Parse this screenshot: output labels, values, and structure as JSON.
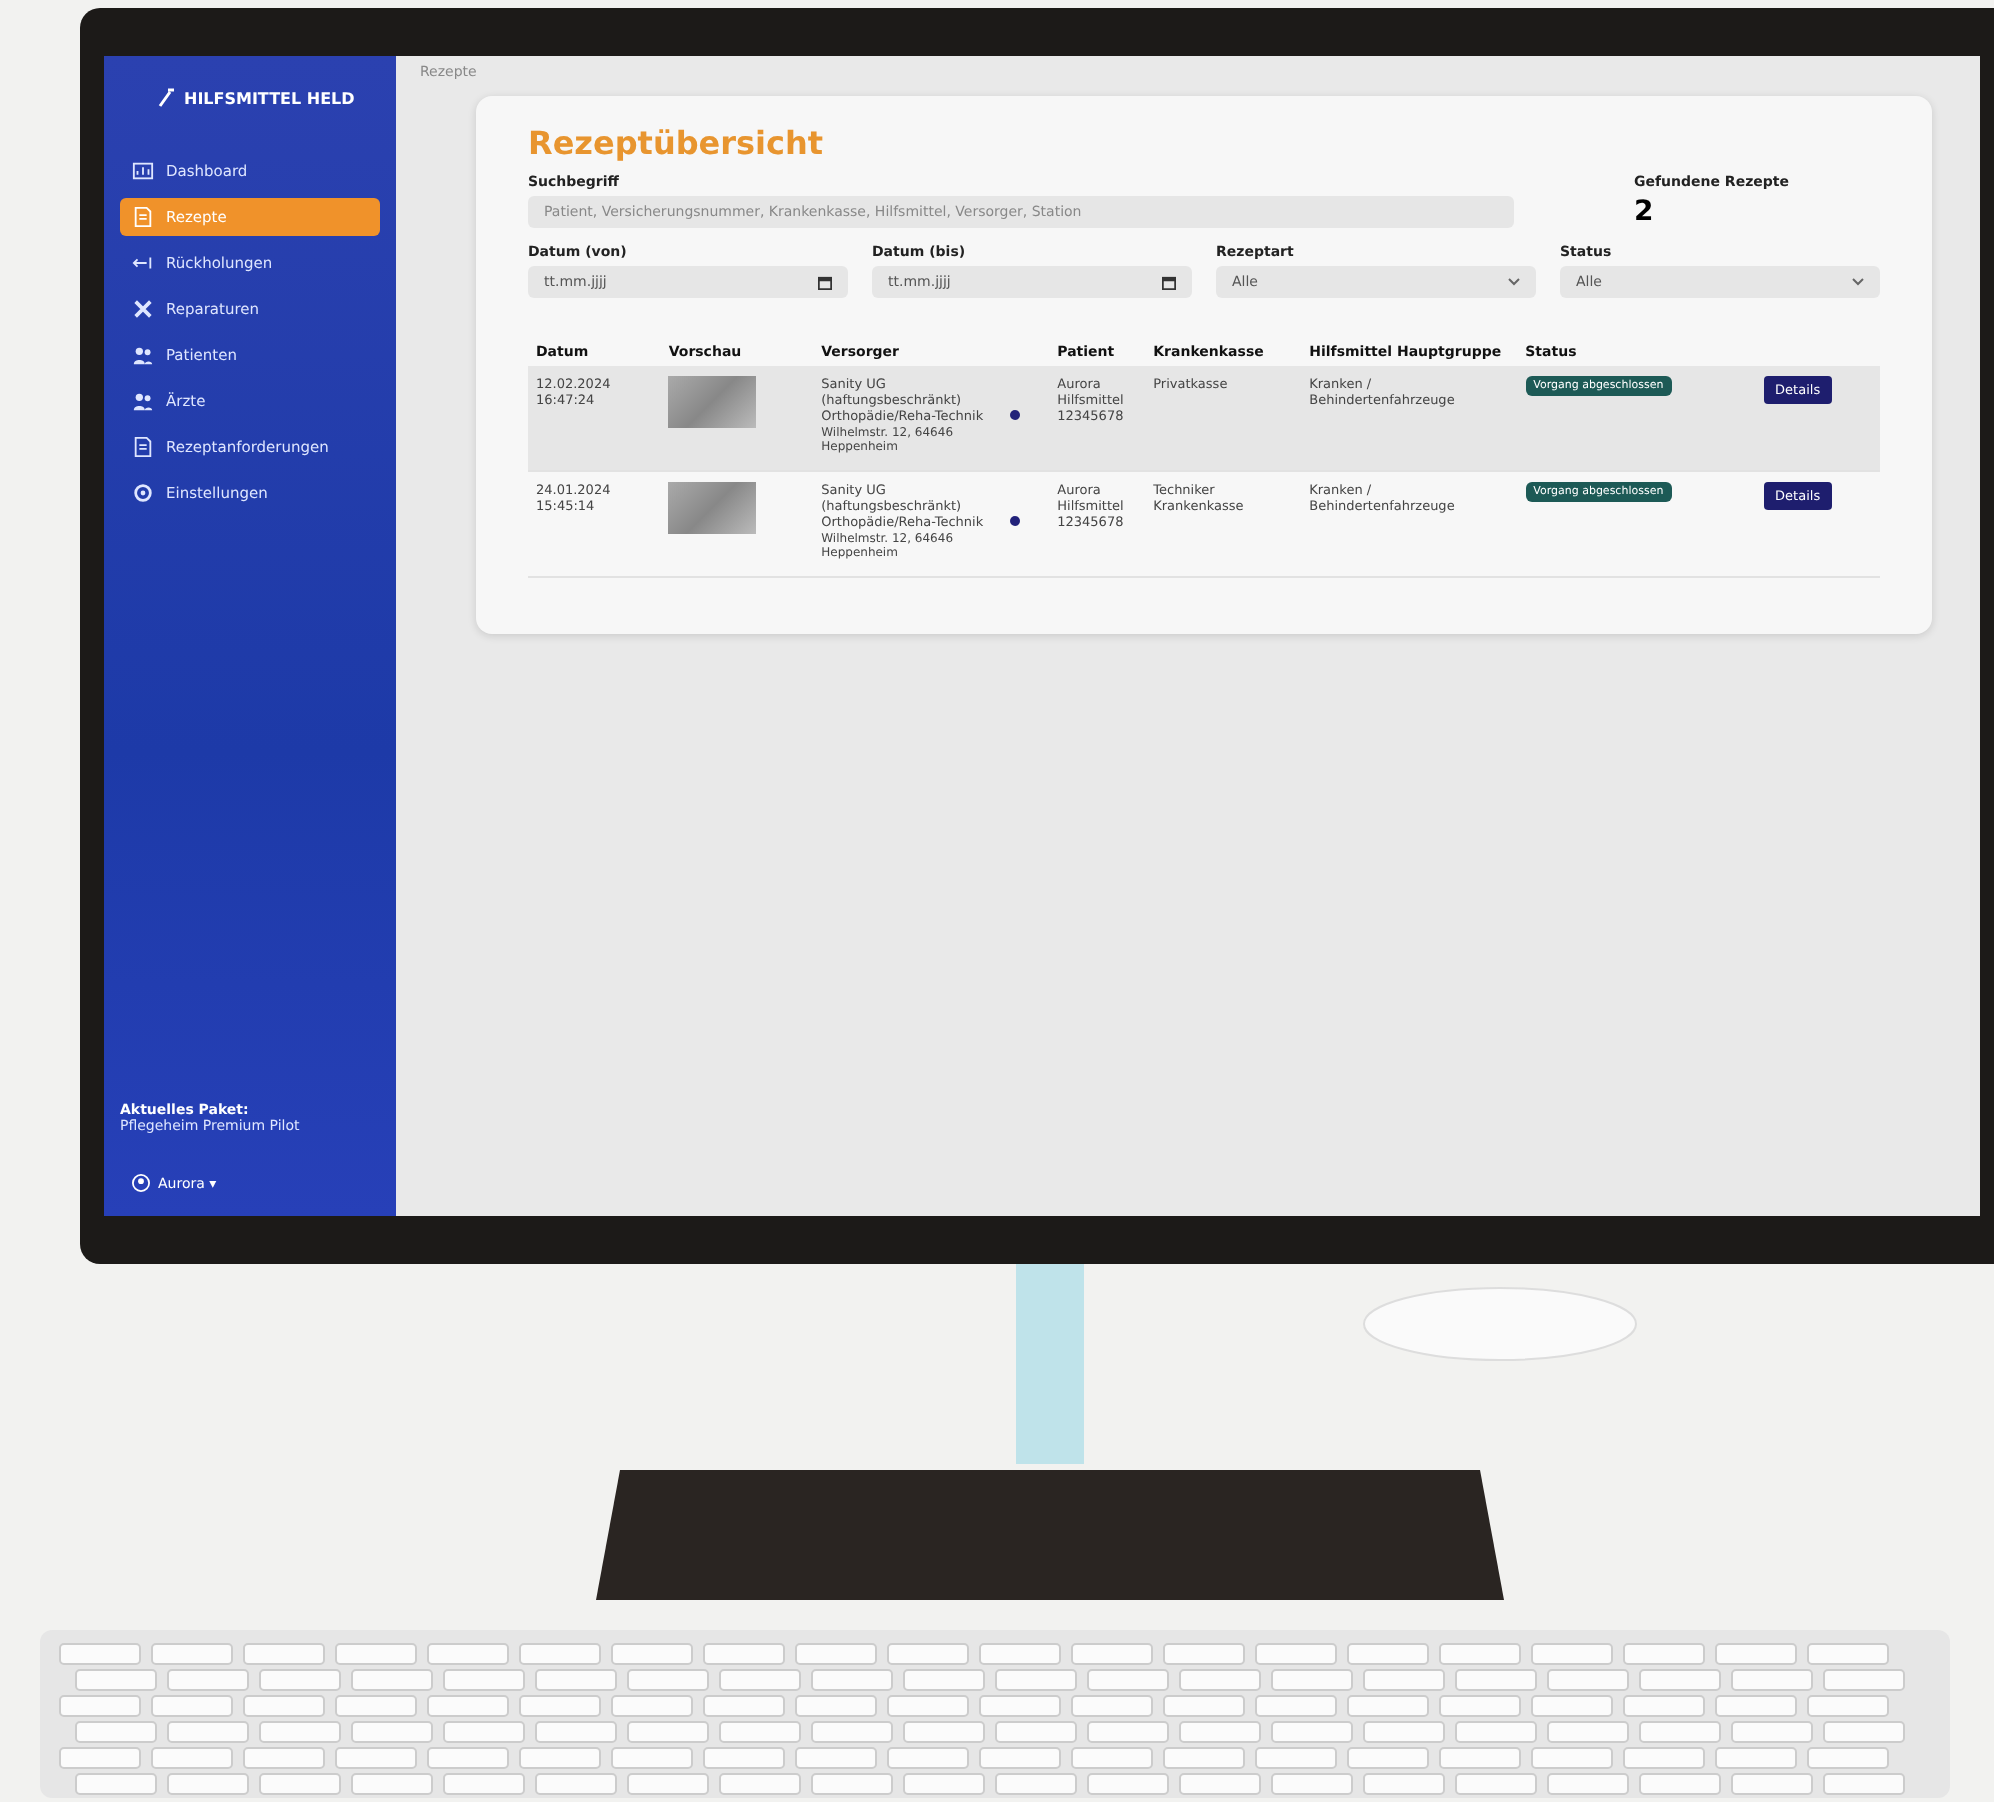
{
  "breadcrumb": "Rezepte",
  "sidebar": {
    "logo": "HILFSMITTEL HELD",
    "items": [
      {
        "label": "Dashboard",
        "selected": false
      },
      {
        "label": "Rezepte",
        "selected": true
      },
      {
        "label": "Rückholungen",
        "selected": false
      },
      {
        "label": "Reparaturen",
        "selected": false
      },
      {
        "label": "Patienten",
        "selected": false
      },
      {
        "label": "Ärzte",
        "selected": false
      },
      {
        "label": "Rezeptanforderungen",
        "selected": false
      },
      {
        "label": "Einstellungen",
        "selected": false
      }
    ],
    "package_label": "Aktuelles Paket:",
    "package_name": "Pflegeheim Premium Pilot",
    "user": "Aurora ▾"
  },
  "page": {
    "title": "Rezeptübersicht",
    "search": {
      "label": "Suchbegriff",
      "placeholder": "Patient, Versicherungsnummer, Krankenkasse, Hilfsmittel, Versorger, Station"
    },
    "found": {
      "label": "Gefundene Rezepte",
      "count": "2"
    },
    "filters": [
      {
        "kind": "date",
        "label": "Datum (von)",
        "placeholder": "tt.mm.jjjj"
      },
      {
        "kind": "date",
        "label": "Datum (bis)",
        "placeholder": "tt.mm.jjjj"
      },
      {
        "kind": "select",
        "label": "Rezeptart",
        "value": "Alle"
      },
      {
        "kind": "select",
        "label": "Status",
        "value": "Alle"
      }
    ]
  },
  "table": {
    "columns": [
      "Datum",
      "Vorschau",
      "Versorger",
      "Patient",
      "Krankenkasse",
      "Hilfsmittel Hauptgruppe",
      "Status"
    ],
    "rows": [
      {
        "selected": true,
        "date": "12.02.2024",
        "time": "16:47:24",
        "provider": "Sanity UG (haftungsbeschränkt) Orthopädie/Reha-Technik",
        "address": "Wilhelmstr. 12, 64646 Heppenheim",
        "patient": "Aurora Hilfsmittel 12345678",
        "insurance": "Privatkasse",
        "group": "Kranken / Behindertenfahrzeuge",
        "status": "Vorgang abgeschlossen",
        "action": "Details"
      },
      {
        "selected": false,
        "date": "24.01.2024",
        "time": "15:45:14",
        "provider": "Sanity UG (haftungsbeschränkt) Orthopädie/Reha-Technik",
        "address": "Wilhelmstr. 12, 64646 Heppenheim",
        "patient": "Aurora Hilfsmittel 12345678",
        "insurance": "Techniker Krankenkasse",
        "group": "Kranken / Behindertenfahrzeuge",
        "status": "Vorgang abgeschlossen",
        "action": "Details"
      }
    ]
  }
}
